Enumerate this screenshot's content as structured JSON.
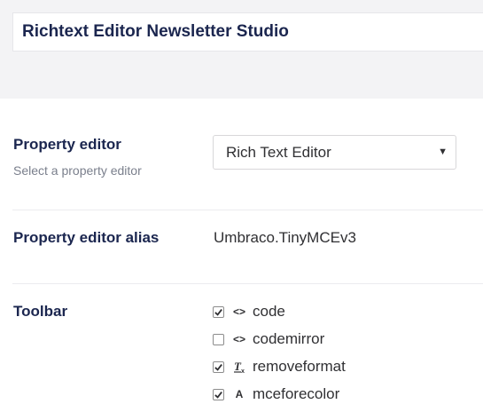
{
  "document": {
    "name_value": "Richtext Editor Newsletter Studio"
  },
  "property_editor": {
    "label": "Property editor",
    "description": "Select a property editor",
    "selected": "Rich Text Editor",
    "caret": "▼"
  },
  "property_editor_alias": {
    "label": "Property editor alias",
    "value": "Umbraco.TinyMCEv3"
  },
  "toolbar": {
    "label": "Toolbar",
    "items": [
      {
        "label": "code",
        "checked": true,
        "icon": "code-icon"
      },
      {
        "label": "codemirror",
        "checked": false,
        "icon": "code-icon"
      },
      {
        "label": "removeformat",
        "checked": true,
        "icon": "remove-format-icon"
      },
      {
        "label": "mceforecolor",
        "checked": true,
        "icon": "font-color-icon"
      }
    ]
  }
}
